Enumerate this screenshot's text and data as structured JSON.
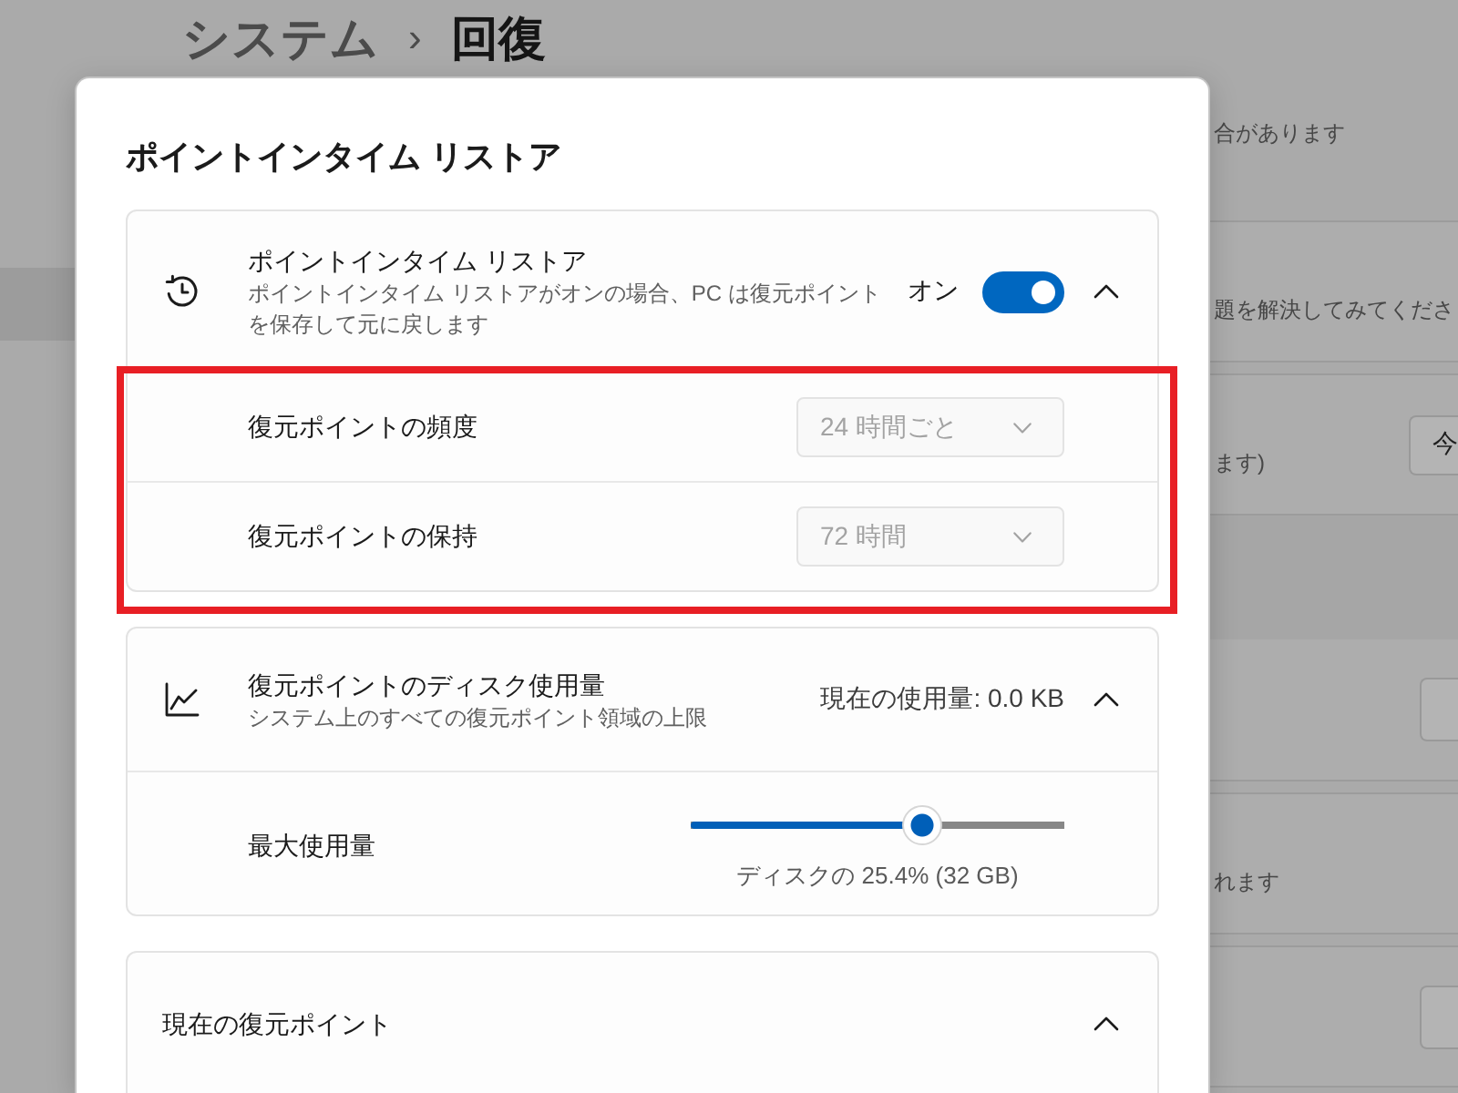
{
  "breadcrumb": {
    "parent": "システム",
    "separator": "›",
    "current": "回復"
  },
  "sidebar": {
    "items": [
      {
        "selected": true
      }
    ]
  },
  "page_rows": [
    {
      "kind": "note",
      "text": "合があります",
      "button": false
    },
    {
      "kind": "card",
      "text": "題を解決してみてくださ",
      "button": false
    },
    {
      "kind": "card",
      "text": "ます)",
      "button": true,
      "button_label": "今"
    },
    {
      "kind": "header",
      "button": false
    },
    {
      "kind": "card",
      "button": true
    },
    {
      "kind": "card",
      "text": "れます",
      "button": false
    },
    {
      "kind": "card",
      "button": true
    }
  ],
  "dialog": {
    "title": "ポイントインタイム リストア",
    "sections": [
      {
        "kind": "toggle",
        "title": "ポイントインタイム リストア",
        "description": "ポイントインタイム リストアがオンの場合、PC は復元ポイントを保存して元に戻します",
        "toggle_label": "オン",
        "on": true,
        "expanded": true,
        "highlighted": true,
        "rows": [
          {
            "kind": "dropdown",
            "label": "復元ポイントの頻度",
            "value": "24 時間ごと",
            "disabled": true
          },
          {
            "kind": "dropdown",
            "label": "復元ポイントの保持",
            "value": "72 時間",
            "disabled": true
          }
        ]
      },
      {
        "kind": "usage",
        "title": "復元ポイントのディスク使用量",
        "description": "システム上のすべての復元ポイント領域の上限",
        "status": "現在の使用量: 0.0 KB",
        "expanded": true,
        "highlighted": false,
        "rows": [
          {
            "kind": "slider",
            "label": "最大使用量",
            "level": 0.62,
            "reading": "ディスクの 25.4% (32 GB)"
          }
        ]
      },
      {
        "kind": "plain",
        "title": "現在の復元ポイント",
        "expanded": true,
        "highlighted": false
      }
    ]
  }
}
